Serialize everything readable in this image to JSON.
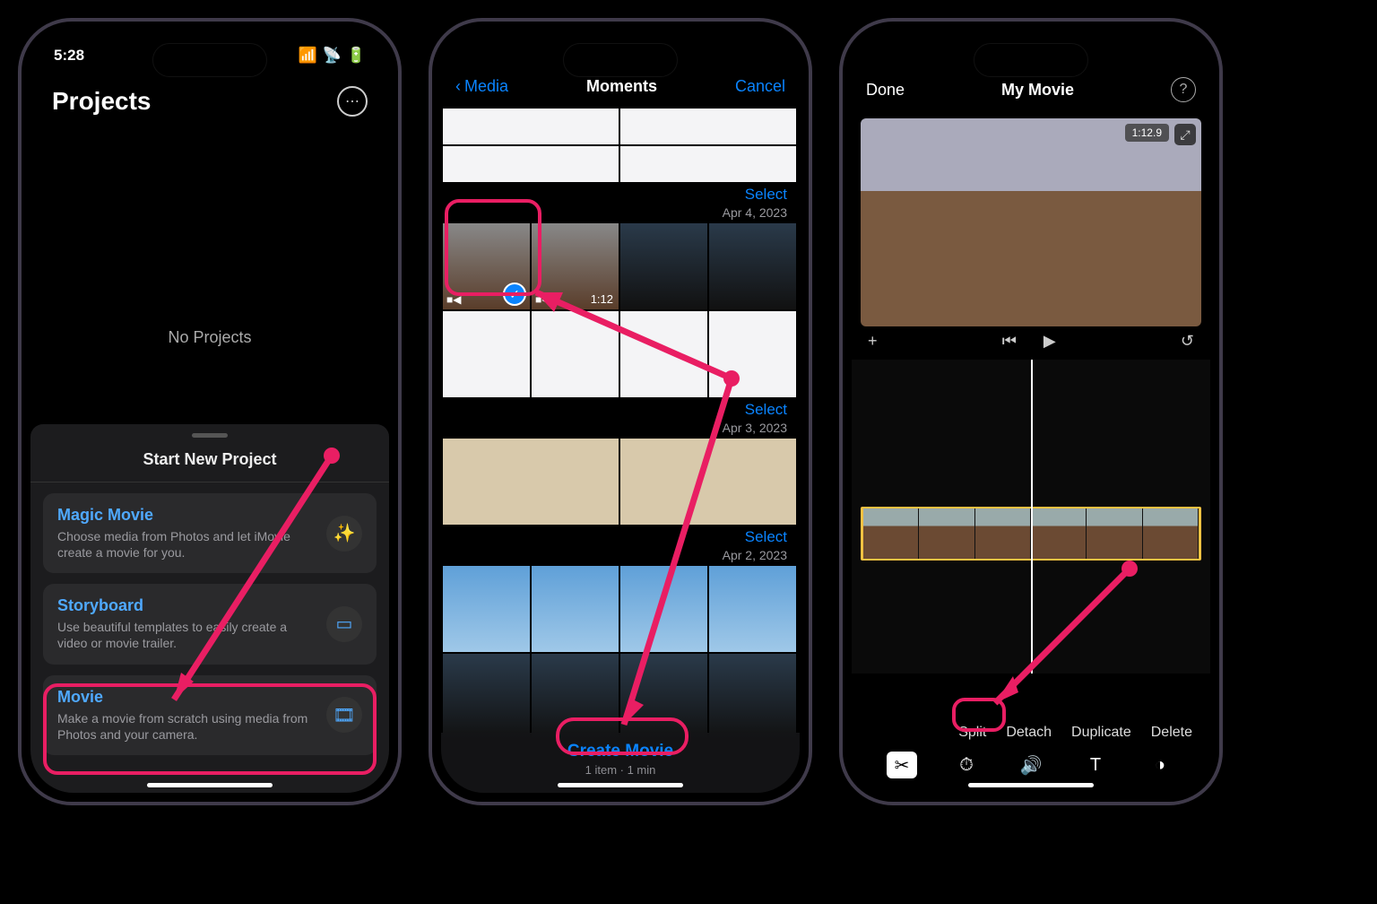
{
  "phone1": {
    "status_time": "5:28",
    "header_title": "Projects",
    "empty_label": "No Projects",
    "sheet_title": "Start New Project",
    "options": [
      {
        "title": "Magic Movie",
        "desc": "Choose media from Photos and let iMovie create a movie for you.",
        "icon": "✨"
      },
      {
        "title": "Storyboard",
        "desc": "Use beautiful templates to easily create a video or movie trailer.",
        "icon": "▭"
      },
      {
        "title": "Movie",
        "desc": "Make a movie from scratch using media from Photos and your camera.",
        "icon": "🎞"
      }
    ]
  },
  "phone2": {
    "back_label": "Media",
    "title": "Moments",
    "cancel_label": "Cancel",
    "sections": [
      {
        "select": "Select",
        "date": "Apr 4, 2023",
        "thumbs": [
          {
            "kind": "deck",
            "video": true,
            "selected": true
          },
          {
            "kind": "deck",
            "video": true,
            "dur": "1:12"
          },
          {
            "kind": "car"
          },
          {
            "kind": "car"
          },
          {
            "kind": "list"
          },
          {
            "kind": "list"
          },
          {
            "kind": "list"
          },
          {
            "kind": "list"
          }
        ]
      },
      {
        "select": "Select",
        "date": "Apr 3, 2023",
        "thumbs": [
          {
            "kind": "paper",
            "wide": true
          },
          {
            "kind": "paper",
            "wide": true
          }
        ]
      },
      {
        "select": "Select",
        "date": "Apr 2, 2023",
        "thumbs": [
          {
            "kind": "sky"
          },
          {
            "kind": "sky"
          },
          {
            "kind": "sky"
          },
          {
            "kind": "sky"
          },
          {
            "kind": "car"
          },
          {
            "kind": "car"
          },
          {
            "kind": "car"
          },
          {
            "kind": "car"
          }
        ]
      }
    ],
    "banner_thumbs": 4,
    "create_label": "Create Movie",
    "create_sub": "1 item · 1 min"
  },
  "phone3": {
    "done_label": "Done",
    "title": "My Movie",
    "preview_time": "1:12.9",
    "toolbar": {
      "plus": "+",
      "prev": "⏮",
      "play": "▶",
      "undo": "↺"
    },
    "clip_frames": 6,
    "actions": [
      "Split",
      "Detach",
      "Duplicate",
      "Delete"
    ],
    "bottom_icons": [
      "scissors",
      "speed",
      "volume",
      "text",
      "filter"
    ]
  }
}
